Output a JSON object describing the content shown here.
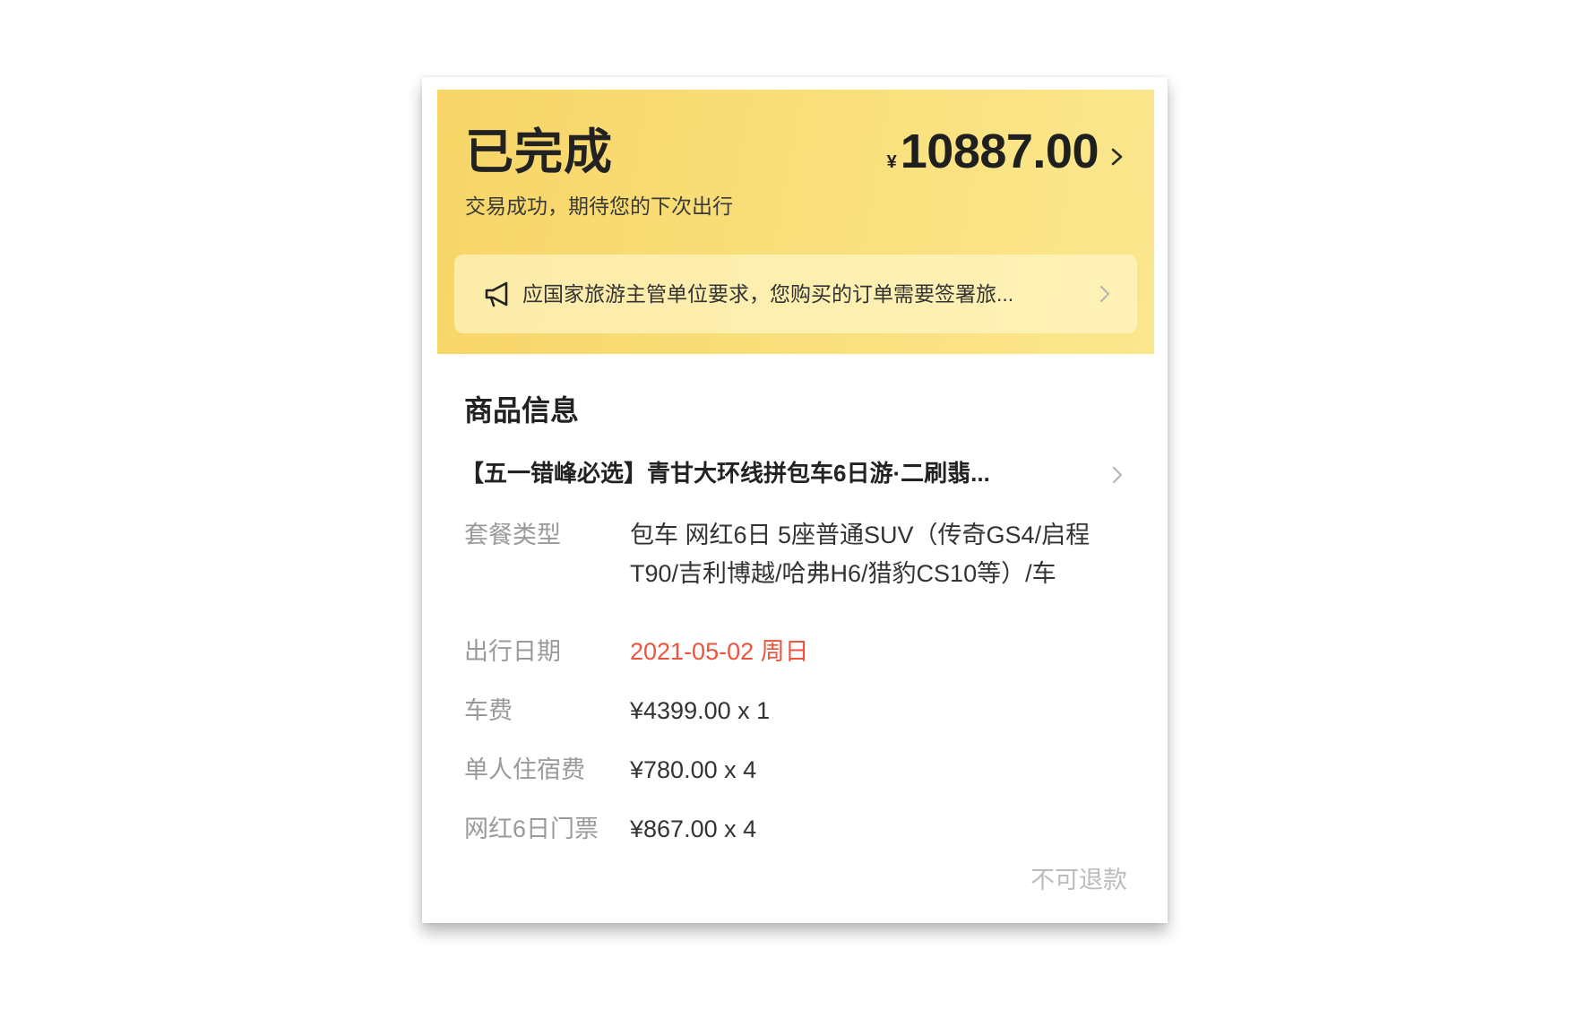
{
  "order": {
    "status_title": "已完成",
    "status_subtitle": "交易成功，期待您的下次出行",
    "currency_symbol": "¥",
    "total_amount": "10887.00"
  },
  "notice": {
    "text": "应国家旅游主管单位要求，您购买的订单需要签署旅..."
  },
  "product_section": {
    "title": "商品信息",
    "product_name": "【五一错峰必选】青甘大环线拼包车6日游·二刷翡...",
    "details": [
      {
        "label": "套餐类型",
        "value": "包车 网红6日 5座普通SUV（传奇GS4/启程T90/吉利博越/哈弗H6/猎豹CS10等）/车"
      },
      {
        "label": "出行日期",
        "value": "2021-05-02 周日"
      },
      {
        "label": "车费",
        "value": "¥4399.00 x 1"
      },
      {
        "label": "单人住宿费",
        "value": "¥780.00 x 4"
      },
      {
        "label": "网红6日门票",
        "value": "¥867.00 x 4"
      }
    ],
    "refund_note": "不可退款"
  },
  "colors": {
    "header_gradient_start": "#f7d567",
    "header_gradient_end": "#fbe78e",
    "date_highlight": "#f0533c",
    "label_gray": "#9a9a9a"
  },
  "icons": {
    "notice": "megaphone-icon",
    "chevron": "chevron-right-icon"
  }
}
